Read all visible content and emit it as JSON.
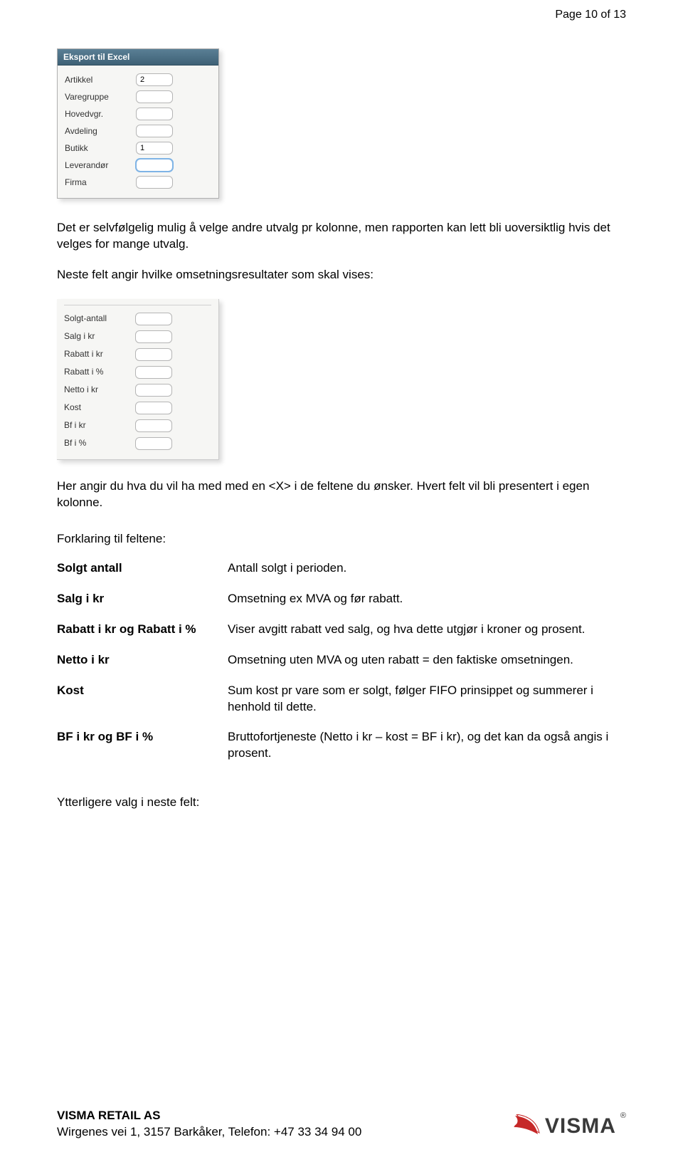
{
  "page_label": "Page 10 of 13",
  "panel1": {
    "header": "Eksport til Excel",
    "rows": [
      {
        "label": "Artikkel",
        "value": "2"
      },
      {
        "label": "Varegruppe",
        "value": ""
      },
      {
        "label": "Hovedvgr.",
        "value": ""
      },
      {
        "label": "Avdeling",
        "value": ""
      },
      {
        "label": "Butikk",
        "value": "1"
      },
      {
        "label": "Leverandør",
        "value": ""
      },
      {
        "label": "Firma",
        "value": ""
      }
    ]
  },
  "para1": "Det er selvfølgelig mulig å velge andre utvalg pr kolonne, men rapporten kan lett bli uoversiktlig hvis det velges for mange utvalg.",
  "para2": "Neste felt angir hvilke omsetningsresultater som skal vises:",
  "panel2": {
    "rows": [
      {
        "label": "Solgt-antall"
      },
      {
        "label": "Salg i kr"
      },
      {
        "label": "Rabatt i kr"
      },
      {
        "label": "Rabatt i %"
      },
      {
        "label": "Netto i kr"
      },
      {
        "label": "Kost"
      },
      {
        "label": "Bf i kr"
      },
      {
        "label": "Bf i %"
      }
    ]
  },
  "para3": "Her angir du hva du vil ha med med en <X> i de feltene du ønsker. Hvert felt vil bli presentert i egen kolonne.",
  "forklaring_title": "Forklaring til feltene:",
  "terms": [
    {
      "term": "Solgt antall",
      "desc": "Antall solgt i perioden."
    },
    {
      "term": "Salg i kr",
      "desc": "Omsetning ex MVA og før rabatt."
    },
    {
      "term": "Rabatt i kr og Rabatt i %",
      "desc": "Viser avgitt rabatt ved salg, og hva dette utgjør i kroner og prosent."
    },
    {
      "term": "Netto i kr",
      "desc": "Omsetning uten MVA og uten rabatt = den faktiske omsetningen."
    },
    {
      "term": "Kost",
      "desc": "Sum kost pr vare som er solgt, følger FIFO prinsippet og summerer i henhold til dette."
    },
    {
      "term": "BF i kr og BF i %",
      "desc": "Bruttofortjeneste (Netto i kr – kost = BF i kr), og det kan da også angis i prosent."
    }
  ],
  "ytterligere": "Ytterligere valg i neste felt:",
  "footer": {
    "company": "VISMA RETAIL AS",
    "address": "Wirgenes vei 1, 3157 Barkåker, Telefon: +47 33 34 94 00",
    "logo_text": "VISMA",
    "logo_r": "®"
  }
}
